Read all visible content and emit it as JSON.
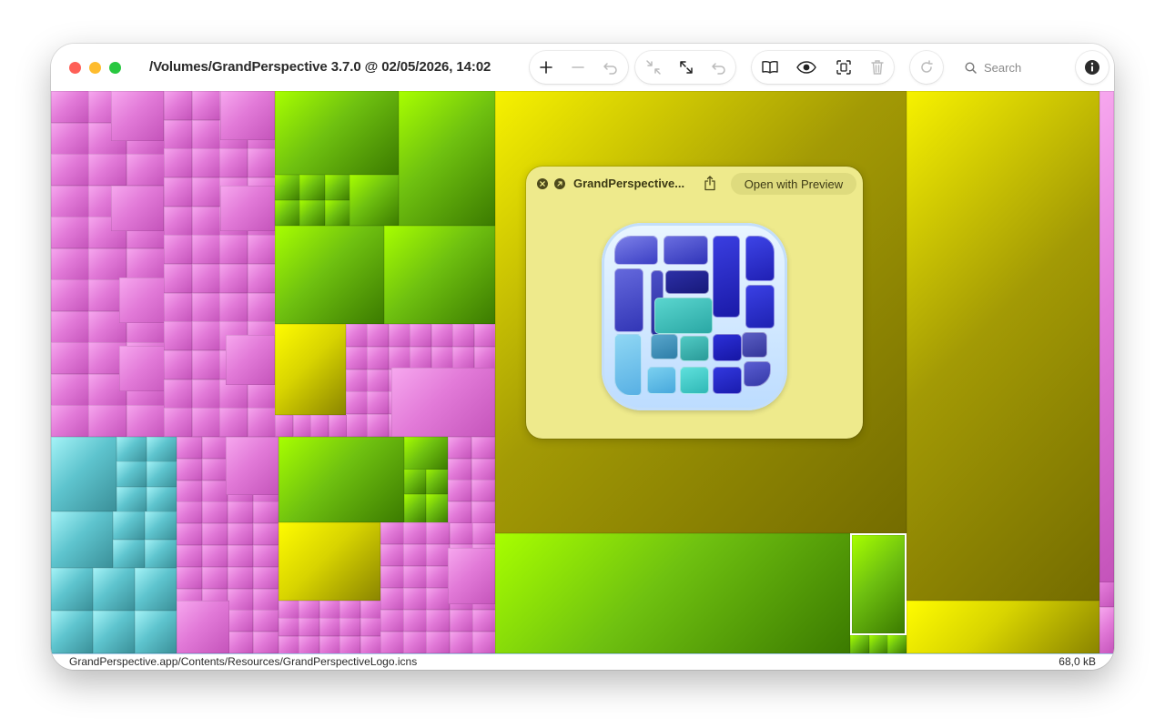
{
  "window": {
    "title": "/Volumes/GrandPerspective 3.7.0 @ 02/05/2026, 14:02",
    "traffic_lights": {
      "close": "#fe5f57",
      "minimize": "#febc2e",
      "zoom": "#28c840"
    }
  },
  "toolbar": {
    "icons": [
      "plus-icon",
      "minus-icon",
      "undo-icon",
      "collapse-icon",
      "expand-icon",
      "redo-back-icon",
      "book-icon",
      "eye-icon",
      "scan-icon",
      "trash-icon",
      "refresh-icon",
      "info-icon"
    ],
    "search_placeholder": "Search"
  },
  "treemap": {
    "colors": {
      "pink": "#e27ad8",
      "green": "#6fc110",
      "yellow": "#d8d400",
      "olive": "#a39a05",
      "teal": "#5ec4ce"
    },
    "selected_border": "#ffffff"
  },
  "popover": {
    "title": "GrandPerspective...",
    "open_button": "Open with Preview",
    "icons": [
      "close-circle-icon",
      "arrow-circle-icon",
      "share-icon"
    ]
  },
  "status": {
    "path": "GrandPerspective.app/Contents/Resources/GrandPerspectiveLogo.icns",
    "size": "68,0 kB"
  }
}
